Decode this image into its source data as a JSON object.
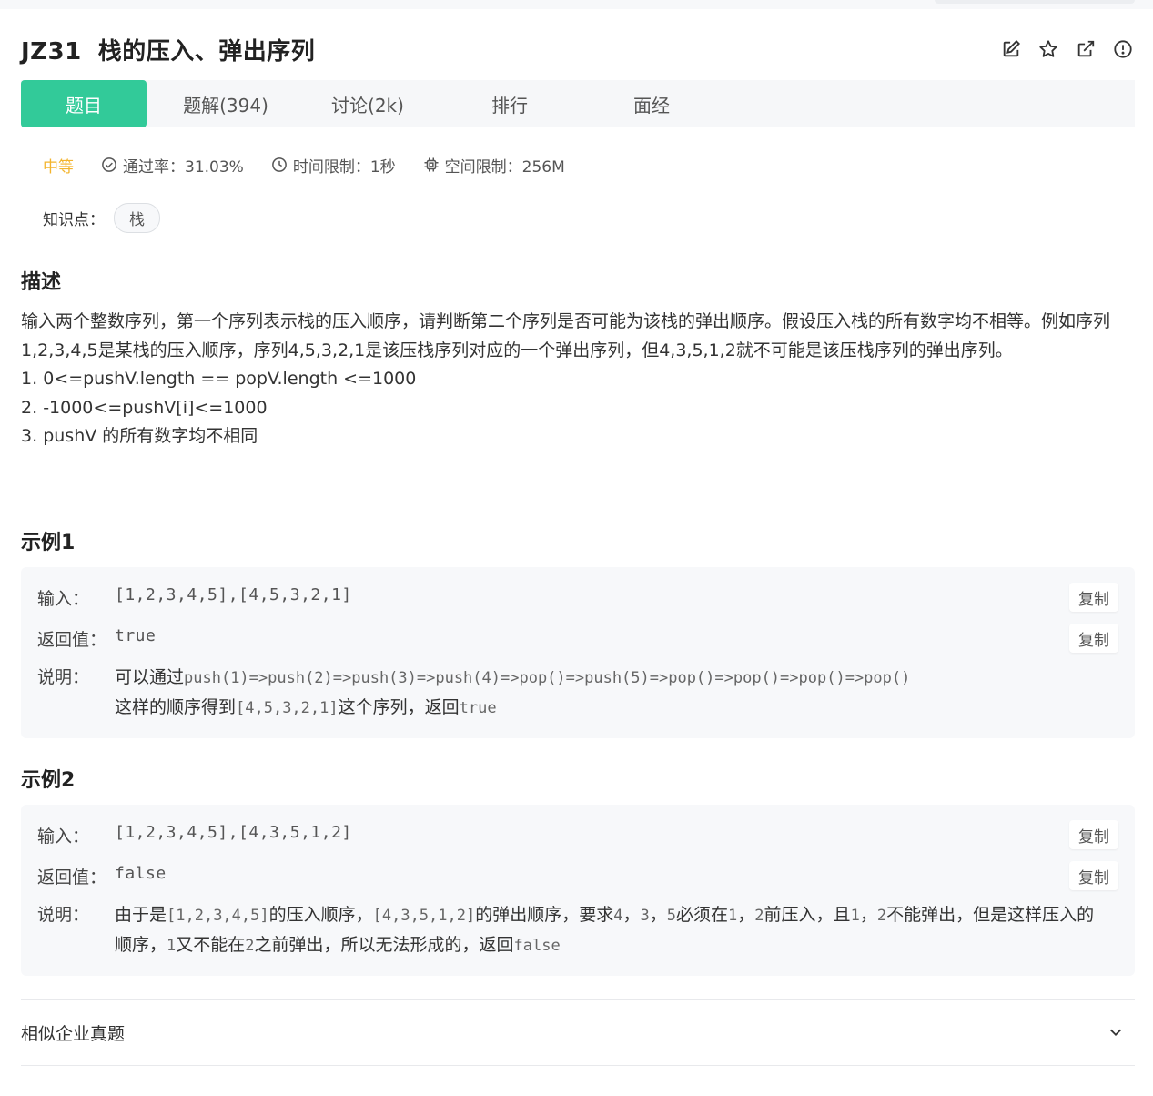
{
  "problem": {
    "code": "JZ31",
    "title": "栈的压入、弹出序列"
  },
  "tabs": [
    {
      "label": "题目"
    },
    {
      "label": "题解(394)"
    },
    {
      "label": "讨论(2k)"
    },
    {
      "label": "排行"
    },
    {
      "label": "面经"
    }
  ],
  "meta": {
    "difficulty": "中等",
    "pass_rate": "通过率：31.03%",
    "time_limit": "时间限制：1秒",
    "space_limit": "空间限制：256M"
  },
  "knowledge": {
    "label": "知识点：",
    "tag": "栈"
  },
  "description": {
    "heading": "描述",
    "paragraph": "输入两个整数序列，第一个序列表示栈的压入顺序，请判断第二个序列是否可能为该栈的弹出顺序。假设压入栈的所有数字均不相等。例如序列1,2,3,4,5是某栈的压入顺序，序列4,5,3,2,1是该压栈序列对应的一个弹出序列，但4,3,5,1,2就不可能是该压栈序列的弹出序列。",
    "constraints": [
      {
        "num": "1.",
        "text": "0<=pushV.length == popV.length <=1000"
      },
      {
        "num": "2.",
        "text": "-1000<=pushV[i]<=1000"
      },
      {
        "num": "3.",
        "text": "pushV 的所有数字均不相同"
      }
    ]
  },
  "example1": {
    "heading": "示例1",
    "input_label": "输入：",
    "input_value": "[1,2,3,4,5],[4,5,3,2,1]",
    "return_label": "返回值：",
    "return_value": "true",
    "explain_label": "说明：",
    "explain_prefix": "可以通过",
    "explain_code": "push(1)=>push(2)=>push(3)=>push(4)=>pop()=>push(5)=>pop()=>pop()=>pop()=>pop()",
    "explain_mid": "这样的顺序得到",
    "explain_code2": "[4,5,3,2,1]",
    "explain_mid2": "这个序列，返回",
    "explain_code3": "true",
    "copy_label": "复制"
  },
  "example2": {
    "heading": "示例2",
    "input_label": "输入：",
    "input_value": "[1,2,3,4,5],[4,3,5,1,2]",
    "return_label": "返回值：",
    "return_value": "false",
    "explain_label": "说明：",
    "e_t1": "由于是",
    "e_c1": "[1,2,3,4,5]",
    "e_t2": "的压入顺序，",
    "e_c2": "[4,3,5,1,2]",
    "e_t3": "的弹出顺序，要求",
    "e_c3": "4",
    "e_t4": "，",
    "e_c4": "3",
    "e_t5": "，",
    "e_c5": "5",
    "e_t6": "必须在",
    "e_c6": "1",
    "e_t7": "，",
    "e_c7": "2",
    "e_t8": "前压入，且",
    "e_c8": "1",
    "e_t9": "，",
    "e_c9": "2",
    "e_t10": "不能弹出，但是这样压入的顺序，",
    "e_c10": "1",
    "e_t11": "又不能在",
    "e_c11": "2",
    "e_t12": "之前弹出，所以无法形成的，返回",
    "e_c12": "false",
    "copy_label": "复制"
  },
  "similar": {
    "label": "相似企业真题"
  },
  "colors": {
    "accent": "#32ca99",
    "difficulty": "#f3b42d"
  }
}
